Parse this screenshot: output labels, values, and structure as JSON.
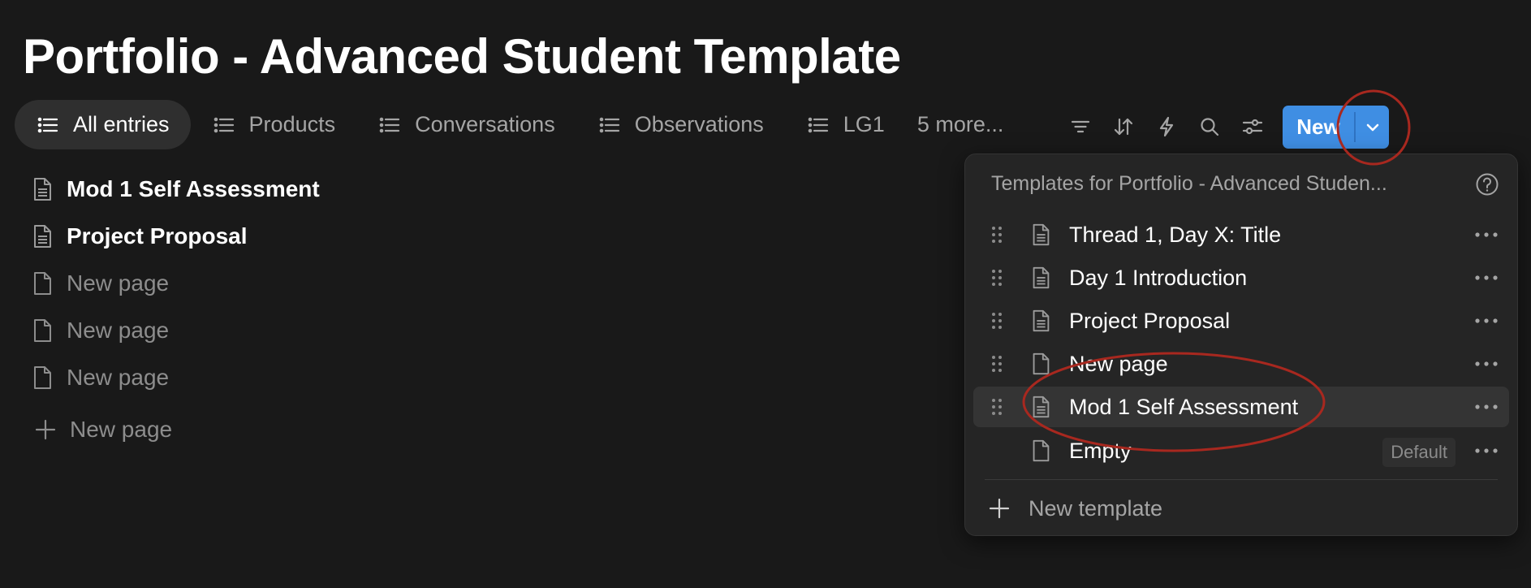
{
  "page": {
    "title": "Portfolio - Advanced Student Template"
  },
  "views": {
    "tabs": [
      {
        "label": "All entries",
        "icon": "list-icon",
        "active": true
      },
      {
        "label": "Products",
        "icon": "list-icon"
      },
      {
        "label": "Conversations",
        "icon": "list-icon"
      },
      {
        "label": "Observations",
        "icon": "list-icon"
      },
      {
        "label": "LG1",
        "icon": "list-icon"
      }
    ],
    "more_label": "5 more..."
  },
  "toolbar": {
    "icons": [
      "filter-icon",
      "sort-icon",
      "automation-bolt-icon",
      "search-icon",
      "settings-sliders-icon"
    ],
    "new_label": "New",
    "accent": "#3f8ee3"
  },
  "entries": [
    {
      "label": "Mod 1 Self Assessment",
      "style": "bold",
      "icon": "document-lines-icon"
    },
    {
      "label": "Project Proposal",
      "style": "bold",
      "icon": "document-lines-icon"
    },
    {
      "label": "New page",
      "style": "dim",
      "icon": "document-empty-icon"
    },
    {
      "label": "New page",
      "style": "dim",
      "icon": "document-empty-icon"
    },
    {
      "label": "New page",
      "style": "dim",
      "icon": "document-empty-icon"
    }
  ],
  "add_page_label": "New page",
  "templates_menu": {
    "title": "Templates for Portfolio - Advanced Studen...",
    "items": [
      {
        "label": "Thread 1, Day X: Title",
        "icon": "document-lines-icon"
      },
      {
        "label": "Day 1 Introduction",
        "icon": "document-lines-icon"
      },
      {
        "label": "Project Proposal",
        "icon": "document-lines-icon"
      },
      {
        "label": "New page",
        "icon": "document-empty-icon"
      },
      {
        "label": "Mod 1 Self Assessment",
        "icon": "document-lines-icon",
        "highlighted": true
      },
      {
        "label": "Empty",
        "icon": "document-empty-icon",
        "badge": "Default"
      }
    ],
    "new_template_label": "New template"
  },
  "annotation_color": "#a8281f"
}
